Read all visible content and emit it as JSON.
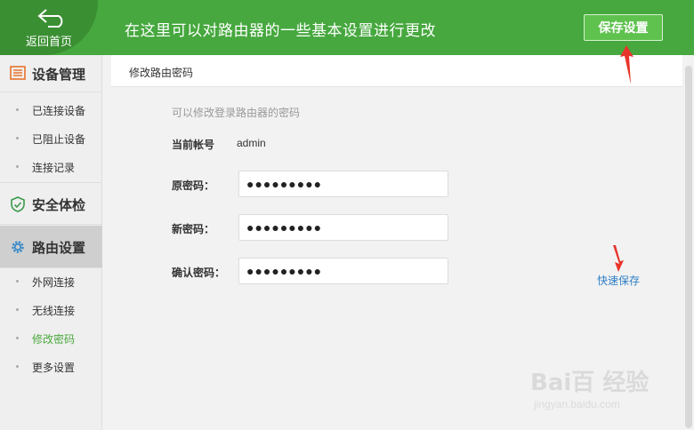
{
  "header": {
    "back_label": "返回首页",
    "title": "在这里可以对路由器的一些基本设置进行更改",
    "save_label": "保存设置"
  },
  "sidebar": {
    "groups": [
      {
        "label": "设备管理",
        "icon": "list-icon",
        "items": [
          "已连接设备",
          "已阻止设备",
          "连接记录"
        ]
      },
      {
        "label": "安全体检",
        "icon": "shield-icon",
        "items": []
      },
      {
        "label": "路由设置",
        "icon": "gear-icon",
        "items": [
          "外网连接",
          "无线连接",
          "修改密码",
          "更多设置"
        ]
      }
    ],
    "active_group": "路由设置",
    "current_item": "修改密码"
  },
  "panel": {
    "title": "修改路由密码",
    "hint": "可以修改登录路由器的密码",
    "account_label": "当前帐号",
    "account_value": "admin",
    "old_label": "原密码：",
    "new_label": "新密码：",
    "confirm_label": "确认密码：",
    "old_value": "●●●●●●●●●",
    "new_value": "●●●●●●●●●",
    "confirm_value": "●●●●●●●●●",
    "quick_save": "快速保存"
  },
  "watermark": {
    "brand": "Bai百 经验",
    "url": "jingyan.baidu.com"
  },
  "colors": {
    "header": "#46a83e",
    "save_button": "#5fc24f",
    "current_item": "#4aa83c",
    "link": "#2f7fc5",
    "annotation": "#e8352b"
  }
}
